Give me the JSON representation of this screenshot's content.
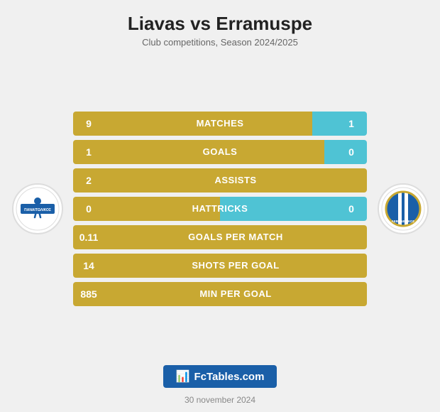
{
  "title": "Liavas vs Erramuspe",
  "subtitle": "Club competitions, Season 2024/2025",
  "stats": [
    {
      "label": "Matches",
      "left": "9",
      "right": "1",
      "has_right": true
    },
    {
      "label": "Goals",
      "left": "1",
      "right": "0",
      "has_right": true
    },
    {
      "label": "Assists",
      "left": "2",
      "right": null,
      "has_right": false
    },
    {
      "label": "Hattricks",
      "left": "0",
      "right": "0",
      "has_right": true
    },
    {
      "label": "Goals per match",
      "left": "0.11",
      "right": null,
      "has_right": false
    },
    {
      "label": "Shots per goal",
      "left": "14",
      "right": null,
      "has_right": false
    },
    {
      "label": "Min per goal",
      "left": "885",
      "right": null,
      "has_right": false
    }
  ],
  "footer": {
    "badge_text": "FcTables.com",
    "date": "30 november 2024"
  }
}
